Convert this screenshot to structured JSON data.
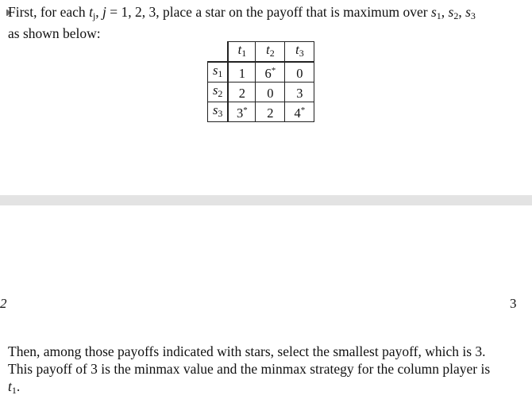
{
  "intro": {
    "t1": "First, for each ",
    "t_var": "t",
    "t_sub": "j",
    "t2": ", ",
    "j_var": "j",
    "t3": " = 1, 2, 3, place a star on the payoff that is maximum over ",
    "s1_var": "s",
    "s1_sub": "1",
    "comma1": ", ",
    "s2_var": "s",
    "s2_sub": "2",
    "comma2": ", ",
    "s3_var": "s",
    "s3_sub": "3",
    "line2": "as shown below:"
  },
  "table": {
    "col_headers": [
      {
        "var": "t",
        "sub": "1"
      },
      {
        "var": "t",
        "sub": "2"
      },
      {
        "var": "t",
        "sub": "3"
      }
    ],
    "rows": [
      {
        "var": "s",
        "sub": "1",
        "cells": [
          {
            "v": "1",
            "star": ""
          },
          {
            "v": "6",
            "star": "*"
          },
          {
            "v": "0",
            "star": ""
          }
        ]
      },
      {
        "var": "s",
        "sub": "2",
        "cells": [
          {
            "v": "2",
            "star": ""
          },
          {
            "v": "0",
            "star": ""
          },
          {
            "v": "3",
            "star": ""
          }
        ]
      },
      {
        "var": "s",
        "sub": "3",
        "cells": [
          {
            "v": "3",
            "star": "*"
          },
          {
            "v": "2",
            "star": ""
          },
          {
            "v": "4",
            "star": "*"
          }
        ]
      }
    ]
  },
  "page_numbers": {
    "left": "2",
    "right": "3"
  },
  "outro": {
    "line1": "Then, among those payoffs indicated with stars, select the smallest payoff, which is 3.",
    "line2": "This payoff of 3 is the minmax value and the minmax strategy for the column player is",
    "t_var": "t",
    "t_sub": "1",
    "end": "."
  }
}
